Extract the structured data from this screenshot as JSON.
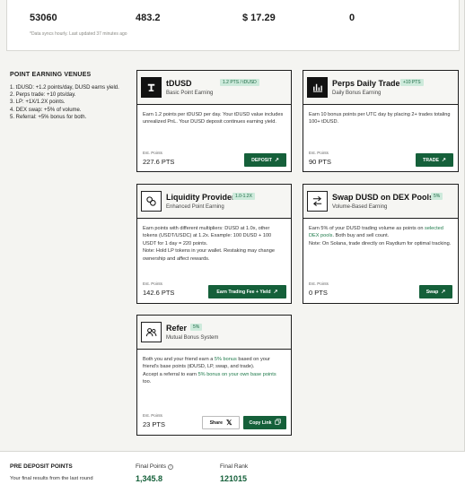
{
  "stats": {
    "values": [
      "53060",
      "483.2",
      "$ 17.29",
      "0"
    ],
    "sync_note": "*Data syncs hourly. Last updated 37 minutes ago"
  },
  "venues": {
    "title": "POINT EARNING VENUES",
    "items": [
      "1. tDUSD: +1.2 points/day, DUSD earns yield.",
      "2. Perps trade: +10 pts/day.",
      "3. LP: +1X/1.2X points.",
      "4. DEX swap: +5% of volume.",
      "5. Referral: +5% bonus for both."
    ]
  },
  "cards": {
    "tdusd": {
      "title": "tDUSD",
      "tag": "1.2 PTS / tDUSD",
      "subtitle": "Basic Point Earning",
      "desc": "Earn 1.2 points per tDUSD per day. Your tDUSD value includes unrealized PnL. Your DUSD deposit continues earning yield.",
      "est_label": "Est. Points",
      "est_value": "227.6 PTS",
      "button": "DEPOSIT",
      "icon": "tdusd-logo-icon"
    },
    "perps": {
      "title": "Perps Daily Trade",
      "tag": "+10 PTS",
      "subtitle": "Daily Bonus Earning",
      "desc": "Earn 10 bonus points per UTC day by placing 2+ trades totaling 100+ tDUSD.",
      "est_label": "Est. Points",
      "est_value": "90 PTS",
      "button": "TRADE",
      "icon": "trade-chart-icon"
    },
    "lp": {
      "title": "Liquidity Provider",
      "tag": "1.0-1.2X",
      "subtitle": "Enhanced Point Earning",
      "desc": "Earn points with different multipliers: DUSD at 1.0x, other tokens (USDT/USDC) at 1.2x. Example: 100 DUSD + 100 USDT for 1 day = 220 points.",
      "note": "Note: Hold LP tokens in your wallet. Restaking may change ownership and affect rewards.",
      "est_label": "Est. Points",
      "est_value": "142.6 PTS",
      "button": "Earn Trading Fee + Yield",
      "icon": "coins-icon"
    },
    "swap": {
      "title": "Swap DUSD on DEX Pools",
      "tag": "5%",
      "subtitle": "Volume-Based Earning",
      "desc_pre": "Earn 5% of your DUSD trading volume as points on ",
      "desc_link": "selected DEX pools",
      "desc_post": ". Both buy and sell count.",
      "note": "Note: On Solana, trade directly on Raydium for optimal tracking.",
      "est_label": "Est. Points",
      "est_value": "0 PTS",
      "button": "Swap",
      "icon": "swap-arrows-icon"
    },
    "refer": {
      "title": "Refer",
      "tag": "5%",
      "subtitle": "Mutual Bonus System",
      "desc_1a": "Both you and your friend earn a ",
      "desc_1b": "5% bonus",
      "desc_1c": " based on your friend's base points (tDUSD, LP, swap, and trade).",
      "desc_2a": "Accept a referral to earn ",
      "desc_2b": "5% bonus on your own base points",
      "desc_2c": " too.",
      "est_label": "Est. Points",
      "est_value": "23 PTS",
      "share_button": "Share",
      "copy_button": "Copy Link",
      "icon": "users-icon"
    }
  },
  "pre_deposit": {
    "title": "PRE DEPOSIT POINTS",
    "subtitle": "Your final results from the last round",
    "final_points_label": "Final Points",
    "final_points_value": "1,345.8",
    "final_rank_label": "Final Rank",
    "final_rank_value": "121015"
  },
  "colors": {
    "accent": "#15603a",
    "tag_bg": "#cdeadb",
    "tag_text": "#1d6a45"
  }
}
